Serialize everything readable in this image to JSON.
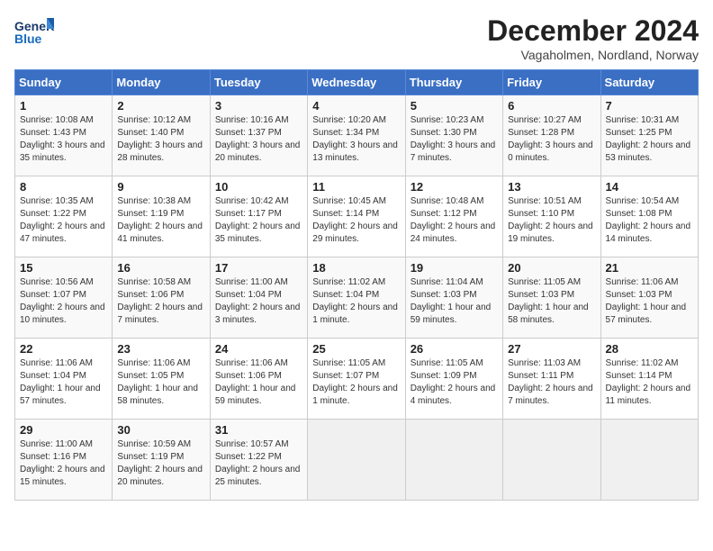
{
  "header": {
    "logo_text_general": "General",
    "logo_text_blue": "Blue",
    "month_title": "December 2024",
    "subtitle": "Vagaholmen, Nordland, Norway"
  },
  "calendar": {
    "days_of_week": [
      "Sunday",
      "Monday",
      "Tuesday",
      "Wednesday",
      "Thursday",
      "Friday",
      "Saturday"
    ],
    "weeks": [
      [
        {
          "day": "1",
          "sunrise": "10:08 AM",
          "sunset": "1:43 PM",
          "daylight": "3 hours and 35 minutes."
        },
        {
          "day": "2",
          "sunrise": "10:12 AM",
          "sunset": "1:40 PM",
          "daylight": "3 hours and 28 minutes."
        },
        {
          "day": "3",
          "sunrise": "10:16 AM",
          "sunset": "1:37 PM",
          "daylight": "3 hours and 20 minutes."
        },
        {
          "day": "4",
          "sunrise": "10:20 AM",
          "sunset": "1:34 PM",
          "daylight": "3 hours and 13 minutes."
        },
        {
          "day": "5",
          "sunrise": "10:23 AM",
          "sunset": "1:30 PM",
          "daylight": "3 hours and 7 minutes."
        },
        {
          "day": "6",
          "sunrise": "10:27 AM",
          "sunset": "1:28 PM",
          "daylight": "3 hours and 0 minutes."
        },
        {
          "day": "7",
          "sunrise": "10:31 AM",
          "sunset": "1:25 PM",
          "daylight": "2 hours and 53 minutes."
        }
      ],
      [
        {
          "day": "8",
          "sunrise": "10:35 AM",
          "sunset": "1:22 PM",
          "daylight": "2 hours and 47 minutes."
        },
        {
          "day": "9",
          "sunrise": "10:38 AM",
          "sunset": "1:19 PM",
          "daylight": "2 hours and 41 minutes."
        },
        {
          "day": "10",
          "sunrise": "10:42 AM",
          "sunset": "1:17 PM",
          "daylight": "2 hours and 35 minutes."
        },
        {
          "day": "11",
          "sunrise": "10:45 AM",
          "sunset": "1:14 PM",
          "daylight": "2 hours and 29 minutes."
        },
        {
          "day": "12",
          "sunrise": "10:48 AM",
          "sunset": "1:12 PM",
          "daylight": "2 hours and 24 minutes."
        },
        {
          "day": "13",
          "sunrise": "10:51 AM",
          "sunset": "1:10 PM",
          "daylight": "2 hours and 19 minutes."
        },
        {
          "day": "14",
          "sunrise": "10:54 AM",
          "sunset": "1:08 PM",
          "daylight": "2 hours and 14 minutes."
        }
      ],
      [
        {
          "day": "15",
          "sunrise": "10:56 AM",
          "sunset": "1:07 PM",
          "daylight": "2 hours and 10 minutes."
        },
        {
          "day": "16",
          "sunrise": "10:58 AM",
          "sunset": "1:06 PM",
          "daylight": "2 hours and 7 minutes."
        },
        {
          "day": "17",
          "sunrise": "11:00 AM",
          "sunset": "1:04 PM",
          "daylight": "2 hours and 3 minutes."
        },
        {
          "day": "18",
          "sunrise": "11:02 AM",
          "sunset": "1:04 PM",
          "daylight": "2 hours and 1 minute."
        },
        {
          "day": "19",
          "sunrise": "11:04 AM",
          "sunset": "1:03 PM",
          "daylight": "1 hour and 59 minutes."
        },
        {
          "day": "20",
          "sunrise": "11:05 AM",
          "sunset": "1:03 PM",
          "daylight": "1 hour and 58 minutes."
        },
        {
          "day": "21",
          "sunrise": "11:06 AM",
          "sunset": "1:03 PM",
          "daylight": "1 hour and 57 minutes."
        }
      ],
      [
        {
          "day": "22",
          "sunrise": "11:06 AM",
          "sunset": "1:04 PM",
          "daylight": "1 hour and 57 minutes."
        },
        {
          "day": "23",
          "sunrise": "11:06 AM",
          "sunset": "1:05 PM",
          "daylight": "1 hour and 58 minutes."
        },
        {
          "day": "24",
          "sunrise": "11:06 AM",
          "sunset": "1:06 PM",
          "daylight": "1 hour and 59 minutes."
        },
        {
          "day": "25",
          "sunrise": "11:05 AM",
          "sunset": "1:07 PM",
          "daylight": "2 hours and 1 minute."
        },
        {
          "day": "26",
          "sunrise": "11:05 AM",
          "sunset": "1:09 PM",
          "daylight": "2 hours and 4 minutes."
        },
        {
          "day": "27",
          "sunrise": "11:03 AM",
          "sunset": "1:11 PM",
          "daylight": "2 hours and 7 minutes."
        },
        {
          "day": "28",
          "sunrise": "11:02 AM",
          "sunset": "1:14 PM",
          "daylight": "2 hours and 11 minutes."
        }
      ],
      [
        {
          "day": "29",
          "sunrise": "11:00 AM",
          "sunset": "1:16 PM",
          "daylight": "2 hours and 15 minutes."
        },
        {
          "day": "30",
          "sunrise": "10:59 AM",
          "sunset": "1:19 PM",
          "daylight": "2 hours and 20 minutes."
        },
        {
          "day": "31",
          "sunrise": "10:57 AM",
          "sunset": "1:22 PM",
          "daylight": "2 hours and 25 minutes."
        },
        null,
        null,
        null,
        null
      ]
    ]
  }
}
